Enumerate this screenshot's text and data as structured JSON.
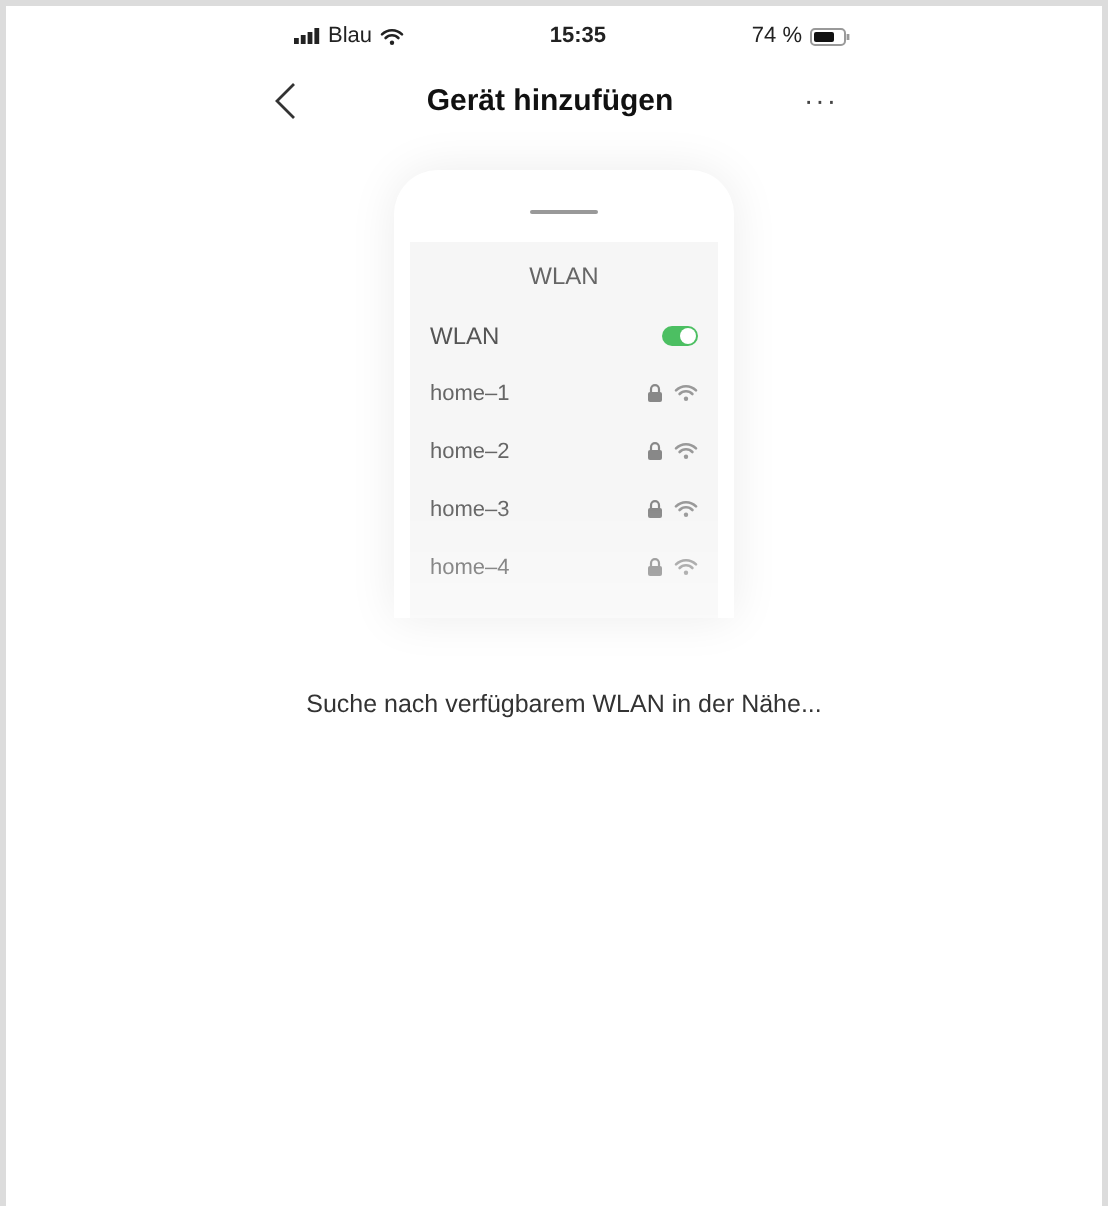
{
  "status_bar": {
    "carrier": "Blau",
    "time": "15:35",
    "battery": "74 %"
  },
  "nav": {
    "title": "Gerät hinzufügen",
    "more": "···"
  },
  "illustration": {
    "header": "WLAN",
    "wlan_label": "WLAN",
    "wlan_on": true,
    "networks": [
      {
        "name": "home–1"
      },
      {
        "name": "home–2"
      },
      {
        "name": "home–3"
      },
      {
        "name": "home–4"
      }
    ]
  },
  "message": "Suche nach verfügbarem WLAN in der Nähe..."
}
